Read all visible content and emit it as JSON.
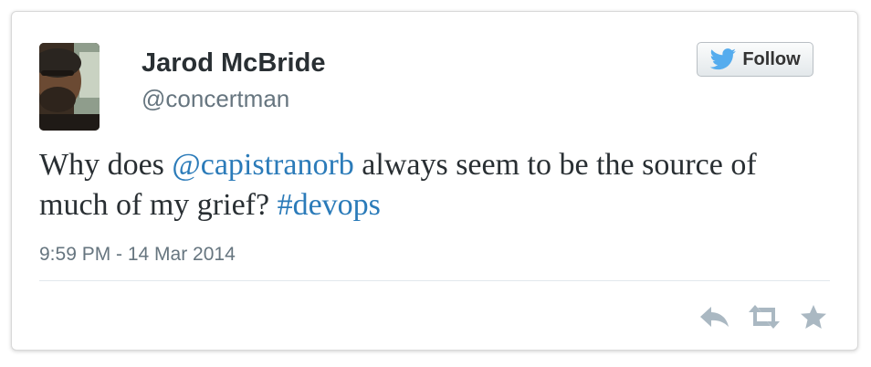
{
  "tweet": {
    "author": {
      "name": "Jarod McBride",
      "handle": "@concertman",
      "avatar_icon": "user-avatar-photo"
    },
    "follow": {
      "label": "Follow",
      "icon": "twitter-bird-icon"
    },
    "text": {
      "part1": "Why does ",
      "mention": "@capistranorb",
      "part2": " always seem to be the source of much of my grief? ",
      "hashtag": "#devops"
    },
    "timestamp": "9:59 PM - 14 Mar 2014",
    "actions": [
      {
        "name": "reply",
        "icon": "reply-icon"
      },
      {
        "name": "retweet",
        "icon": "retweet-icon"
      },
      {
        "name": "favorite",
        "icon": "star-icon"
      }
    ]
  },
  "colors": {
    "link": "#2b7bb9",
    "text": "#292f33",
    "muted": "#66757f",
    "twitter_blue": "#55acee",
    "action_icon": "#aab8c2"
  }
}
